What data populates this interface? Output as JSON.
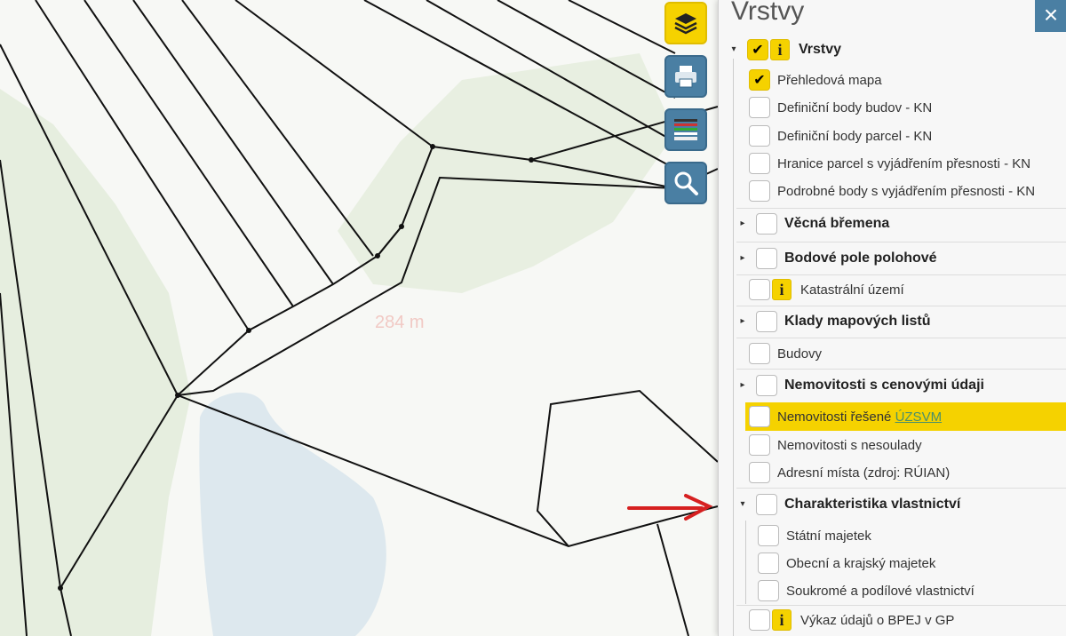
{
  "map": {
    "scale_label": "284 m"
  },
  "toolbar": {
    "layers": "layers-icon",
    "print": "printer-icon",
    "legend": "legend-icon",
    "search": "search-icon"
  },
  "panel": {
    "title": "Vrstvy",
    "close_label": "×",
    "root_label": "Vrstvy",
    "items": {
      "prehledova": "Přehledová mapa",
      "def_budov": "Definiční body budov - KN",
      "def_parcel": "Definiční body parcel - KN",
      "hranice": "Hranice parcel s vyjádřením přesnosti - KN",
      "podrobne": "Podrobné body s vyjádřením přesnosti - KN",
      "vecna": "Věcná břemena",
      "bodove": "Bodové pole polohové",
      "katastralni": "Katastrální území",
      "klady": "Klady mapových listů",
      "budovy": "Budovy",
      "nemovitosti_cenove": "Nemovitosti s cenovými údaji",
      "nemovitosti_resene": "Nemovitosti řešené",
      "uzsvm": "ÚZSVM",
      "nesoulady": "Nemovitosti s nesoulady",
      "adresni": "Adresní místa (zdroj: RÚIAN)",
      "charakteristika": "Charakteristika vlastnictví",
      "statni": "Státní majetek",
      "obecni": "Obecní a krajský majetek",
      "soukrome": "Soukromé a podílové vlastnictví",
      "vykaz": "Výkaz údajů o BPEJ v GP"
    },
    "info_glyph": "i",
    "check_glyph": "✔"
  },
  "colors": {
    "accent": "#f5d200",
    "button": "#4a7fa3",
    "arrow": "#d62020"
  }
}
